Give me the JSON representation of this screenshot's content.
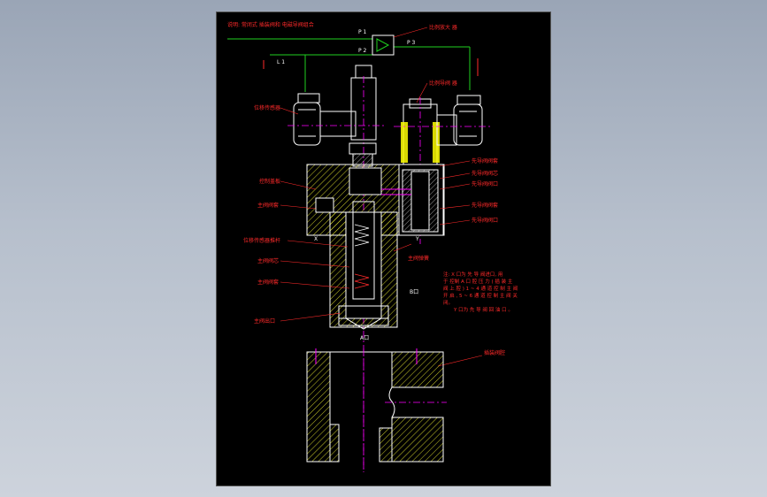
{
  "title_note": "说明: 常闭式 插装阀和 电磁导阀组合",
  "signals": {
    "p1": "P 1",
    "p2": "P 2",
    "p3": "P 3",
    "l1": "L 1"
  },
  "labels": {
    "amplifier": "比例放大 器",
    "pilot_valve": "比例导阀 器",
    "position_sensor": "位移传感器",
    "valve_cover": "控制盖板",
    "main_spool_seat": "主阀阀套",
    "sensor_rod": "位移传感器推杆",
    "main_spool": "主阀阀芯",
    "main_valve_sleeve": "主阀阀套",
    "main_outlet_port": "主阀出口",
    "right_1": "先导阀阀套",
    "right_2": "先导阀阀芯",
    "right_3": "先导阀阀口",
    "right_4": "先导阀阀套",
    "right_5": "先导阀阀口",
    "spring": "主阀弹簧",
    "port_b": "B口",
    "port_a": "A口",
    "cavity": "插装阀腔",
    "port_x": "X",
    "port_y": "Y"
  },
  "notes": [
    "注: X 口为 先 导 阀进口, 用",
    "于 控制 A 口 腔 压 力 ( 插 装 主",
    "阀 上 腔 ) 1 ~ 4 通 道 控 制 主 阀",
    "开 启 , 5 ~ 6 通 道 控 制 主 阀 关",
    "闭。",
    "Y 口为 先 导 阀 回 油 口 。"
  ],
  "colors": {
    "outline": "#ffffff",
    "label": "#ff2a2a",
    "centerline": "#ff00ff",
    "signal": "#1fd11f",
    "coil": "#ffff00",
    "hatch": "#ffff33"
  }
}
